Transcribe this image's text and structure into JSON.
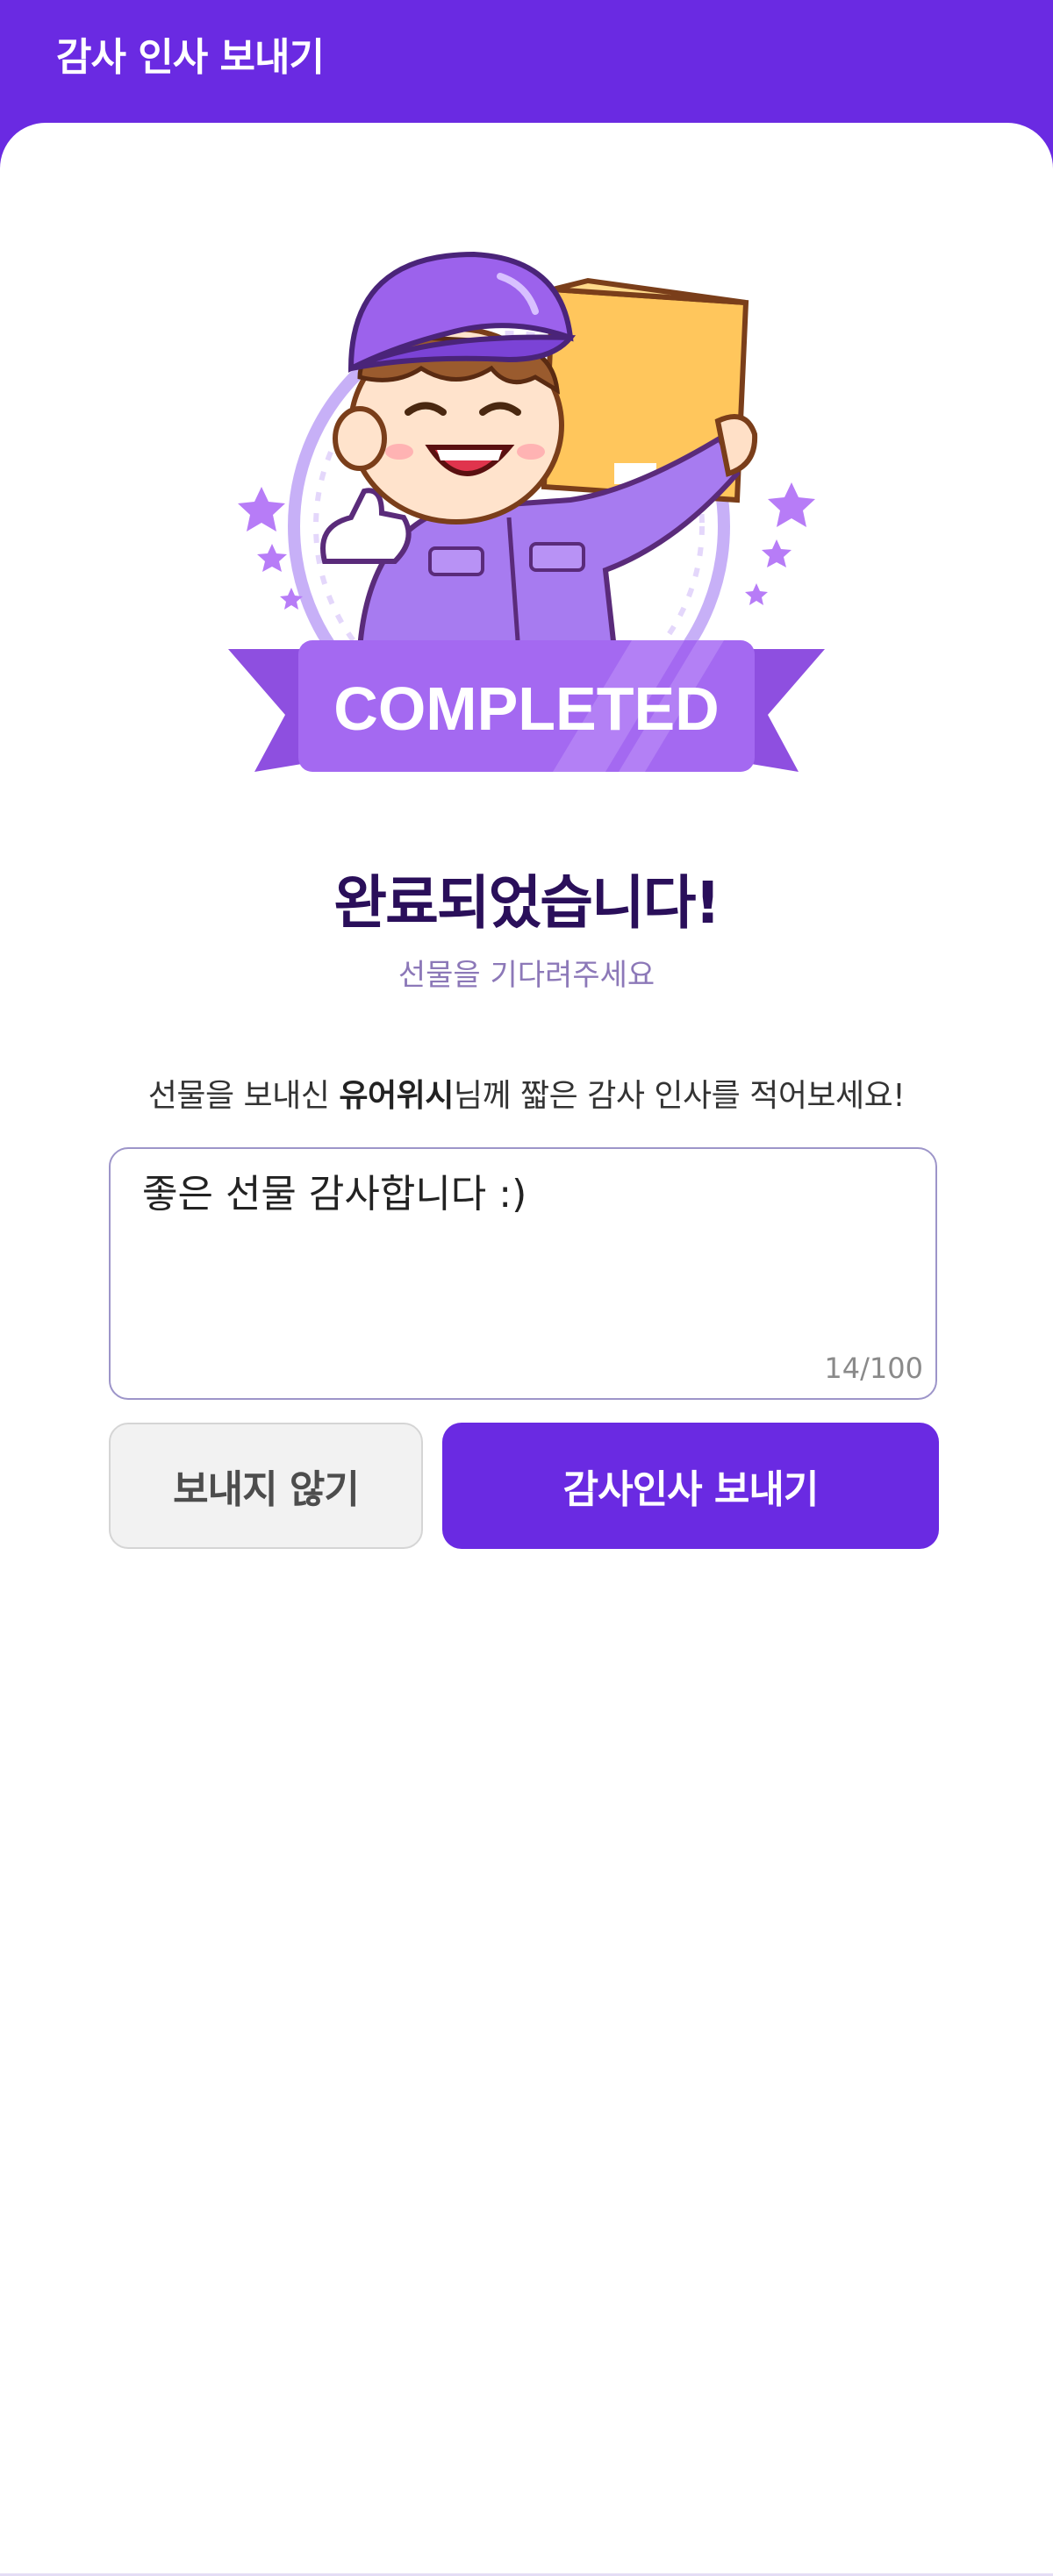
{
  "header": {
    "title": "감사 인사 보내기"
  },
  "illustration": {
    "badge_text": "COMPLETED"
  },
  "main": {
    "headline": "완료되었습니다!",
    "subline": "선물을 기다려주세요",
    "prompt_before": "선물을 보내신 ",
    "sender_name": "유어위시",
    "prompt_after": "님께 짧은 감사 인사를 적어보세요!"
  },
  "message_box": {
    "value": "좋은 선물 감사합니다 :)",
    "counter": "14/100"
  },
  "actions": {
    "skip_label": "보내지 않기",
    "send_label": "감사인사 보내기"
  },
  "colors": {
    "brand": "#6a2ae2",
    "headline": "#2a0f5a",
    "subline": "#8c78b8"
  }
}
